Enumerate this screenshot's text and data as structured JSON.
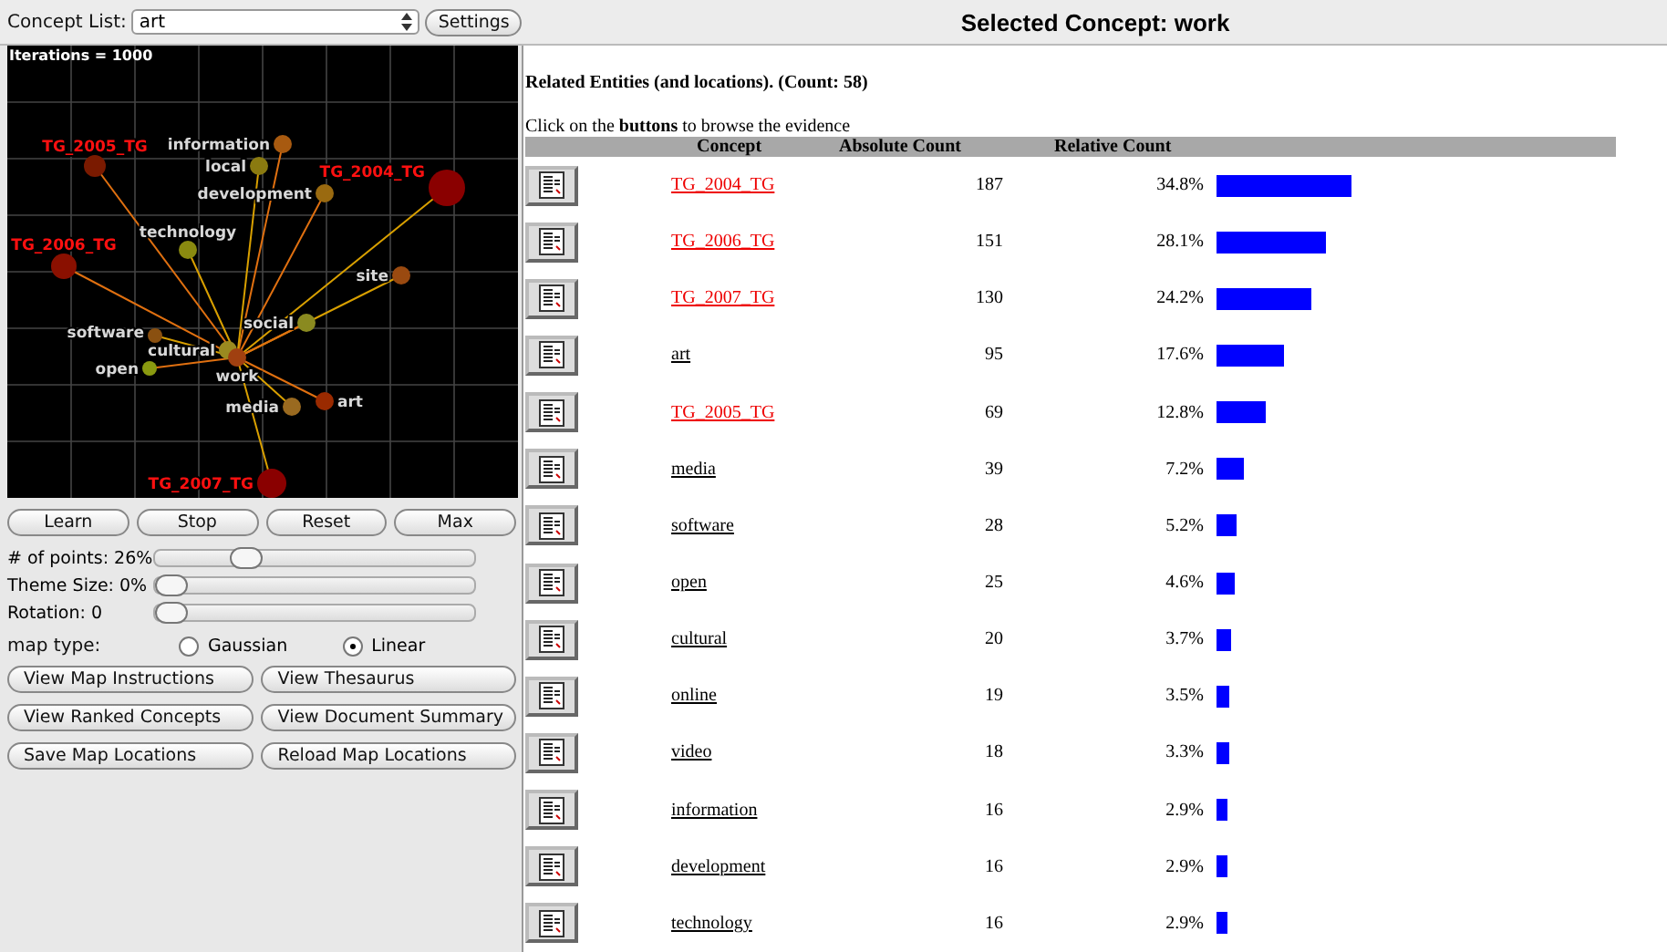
{
  "concept_list": {
    "label": "Concept List:",
    "value": "art"
  },
  "settings_button": "Settings",
  "title": "Selected Concept: work",
  "map": {
    "iterations": "Iterations = 1000",
    "nodes": [
      {
        "label": "information",
        "kind": "concept",
        "color": "#a85a10"
      },
      {
        "label": "local",
        "kind": "concept",
        "color": "#8a7a10"
      },
      {
        "label": "development",
        "kind": "concept",
        "color": "#9a6a10"
      },
      {
        "label": "TG_2004_TG",
        "kind": "tag",
        "color": "#8a0000"
      },
      {
        "label": "TG_2005_TG",
        "kind": "tag",
        "color": "#7a1a00"
      },
      {
        "label": "technology",
        "kind": "concept",
        "color": "#8a8a10"
      },
      {
        "label": "TG_2006_TG",
        "kind": "tag",
        "color": "#8a1000"
      },
      {
        "label": "site",
        "kind": "concept",
        "color": "#9a4a10"
      },
      {
        "label": "social",
        "kind": "concept",
        "color": "#8a8a20"
      },
      {
        "label": "software",
        "kind": "concept",
        "color": "#8a5010"
      },
      {
        "label": "cultural",
        "kind": "concept",
        "color": "#9a8a20"
      },
      {
        "label": "work",
        "kind": "concept",
        "color": "#a04010"
      },
      {
        "label": "open",
        "kind": "concept",
        "color": "#8a9a10"
      },
      {
        "label": "media",
        "kind": "concept",
        "color": "#9a6a20"
      },
      {
        "label": "art",
        "kind": "concept",
        "color": "#9a2a00"
      },
      {
        "label": "TG_2007_TG",
        "kind": "tag",
        "color": "#8a0000"
      }
    ]
  },
  "map_buttons": [
    "Learn",
    "Stop",
    "Reset",
    "Max"
  ],
  "sliders": [
    {
      "label": "# of points: 26%",
      "level": 0.26
    },
    {
      "label": "Theme Size: 0%",
      "level": 0
    },
    {
      "label": "Rotation: 0",
      "level": 0
    }
  ],
  "map_type": {
    "label": "map type:",
    "options": [
      {
        "label": "Gaussian",
        "selected": false
      },
      {
        "label": "Linear",
        "selected": true
      }
    ]
  },
  "action_buttons": [
    "View Map Instructions",
    "View Thesaurus",
    "View Ranked Concepts",
    "View Document Summary",
    "Save Map Locations",
    "Reload Map Locations"
  ],
  "related": {
    "heading": "Related Entities (and locations). (Count: 58)",
    "instruction": "Click on the **buttons** to browse the evidence",
    "columns": [
      "Concept",
      "Absolute Count",
      "Relative Count"
    ],
    "rows": [
      {
        "concept": "TG_2004_TG",
        "kind": "tag",
        "absolute": "187",
        "relative": "34.8%"
      },
      {
        "concept": "TG_2006_TG",
        "kind": "tag",
        "absolute": "151",
        "relative": "28.1%"
      },
      {
        "concept": "TG_2007_TG",
        "kind": "tag",
        "absolute": "130",
        "relative": "24.2%"
      },
      {
        "concept": "art",
        "kind": "concept",
        "absolute": "95",
        "relative": "17.6%"
      },
      {
        "concept": "TG_2005_TG",
        "kind": "tag",
        "absolute": "69",
        "relative": "12.8%"
      },
      {
        "concept": "media",
        "kind": "concept",
        "absolute": "39",
        "relative": "7.2%"
      },
      {
        "concept": "software",
        "kind": "concept",
        "absolute": "28",
        "relative": "5.2%"
      },
      {
        "concept": "open",
        "kind": "concept",
        "absolute": "25",
        "relative": "4.6%"
      },
      {
        "concept": "cultural",
        "kind": "concept",
        "absolute": "20",
        "relative": "3.7%"
      },
      {
        "concept": "online",
        "kind": "concept",
        "absolute": "19",
        "relative": "3.5%"
      },
      {
        "concept": "video",
        "kind": "concept",
        "absolute": "18",
        "relative": "3.3%"
      },
      {
        "concept": "information",
        "kind": "concept",
        "absolute": "16",
        "relative": "2.9%"
      },
      {
        "concept": "development",
        "kind": "concept",
        "absolute": "16",
        "relative": "2.9%"
      },
      {
        "concept": "technology",
        "kind": "concept",
        "absolute": "16",
        "relative": "2.9%"
      }
    ]
  }
}
